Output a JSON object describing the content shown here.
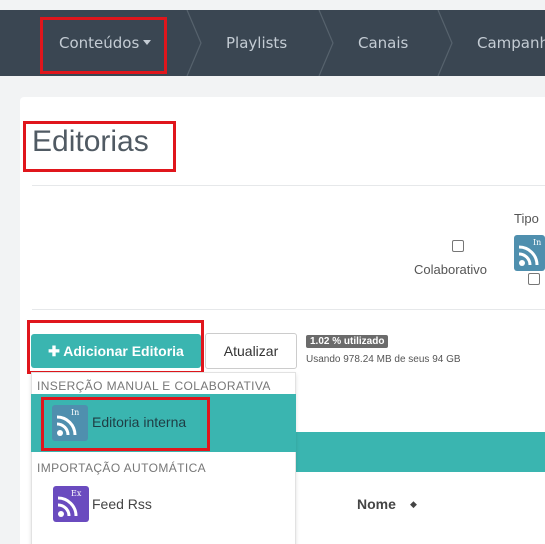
{
  "nav": {
    "items": [
      {
        "label": "Conteúdos",
        "has_dropdown": true
      },
      {
        "label": "Playlists"
      },
      {
        "label": "Canais"
      },
      {
        "label": "Campanh"
      }
    ]
  },
  "page": {
    "title": "Editorias"
  },
  "filters": {
    "collab_label": "Colaborativo",
    "tipo_label": "Tipo"
  },
  "toolbar": {
    "add_label": "Adicionar Editoria",
    "update_label": "Atualizar",
    "usage_badge": "1.02 % utilizado",
    "usage_text": "Usando 978.24 MB de seus 94 GB"
  },
  "dropdown": {
    "section1": "INSERÇÃO MANUAL E COLABORATIVA",
    "item1": {
      "label": "Editoria interna",
      "icon_tag": "In"
    },
    "section2": "IMPORTAÇÃO AUTOMÁTICA",
    "item2": {
      "label": "Feed Rss",
      "icon_tag": "Ex"
    }
  },
  "table": {
    "col_nome": "Nome"
  },
  "colors": {
    "nav_bg": "#3a4652",
    "accent": "#3ab5b0",
    "highlight": "#e0161c",
    "rss_internal": "#4f8fae",
    "rss_external": "#6a4bbf"
  },
  "icons": [
    "caret-down-icon",
    "plus-icon",
    "rss-internal-icon",
    "rss-external-icon",
    "sort-icon"
  ]
}
